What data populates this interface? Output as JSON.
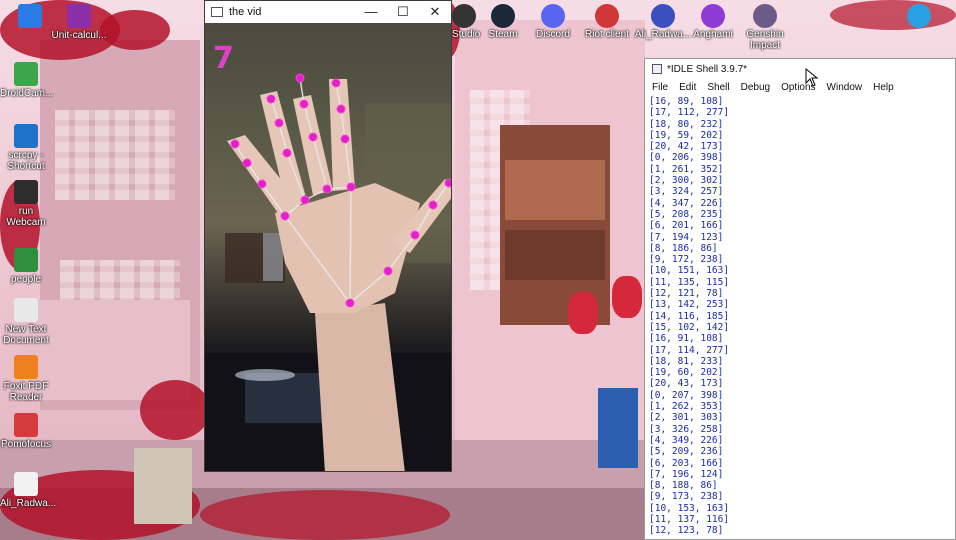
{
  "desktop_icons_left": [
    {
      "label": "",
      "icon": "folder-icon",
      "color": "#2a7be4"
    },
    {
      "label": "Unit-calcul...",
      "icon": "winrar-icon",
      "color": "#8b2fa8"
    },
    {
      "label": "DroidCam...",
      "icon": "droidcam-icon",
      "color": "#3ca64a"
    },
    {
      "label": "scrcpy - Shortcut",
      "icon": "scrcpy-icon",
      "color": "#1e72c8"
    },
    {
      "label": "run Webcam",
      "icon": "webcam-icon",
      "color": "#2d2d2d"
    },
    {
      "label": "people",
      "icon": "people-icon",
      "color": "#2f8f3f"
    },
    {
      "label": "New Text Document",
      "icon": "text-document-icon",
      "color": "#e8e8e8"
    },
    {
      "label": "Foxit PDF Reader",
      "icon": "foxit-icon",
      "color": "#f0801c"
    },
    {
      "label": "Pomofocus",
      "icon": "pomofocus-icon",
      "color": "#d63b3b"
    },
    {
      "label": "Ali_Radwa...",
      "icon": "document-icon",
      "color": "#f2f2f2"
    }
  ],
  "desktop_icons_top": [
    {
      "label": "Studio",
      "icon": "studio-icon",
      "color": "#333"
    },
    {
      "label": "Steam",
      "icon": "steam-icon",
      "color": "#1b2838"
    },
    {
      "label": "Discord",
      "icon": "discord-icon",
      "color": "#5865f2"
    },
    {
      "label": "Riot client",
      "icon": "riot-icon",
      "color": "#d13639"
    },
    {
      "label": "Ali_Radwa...",
      "icon": "pdf-icon",
      "color": "#3c4fbf"
    },
    {
      "label": "Anghami",
      "icon": "anghami-icon",
      "color": "#8e3ad6"
    },
    {
      "label": "Genshin Impact",
      "icon": "genshin-icon",
      "color": "#6b5a8a"
    },
    {
      "label": "",
      "icon": "folder-icon",
      "color": "#2aa0e4"
    }
  ],
  "video_window": {
    "title": "the vid",
    "finger_count": "7",
    "controls": {
      "minimize": "—",
      "maximize": "☐",
      "close": "✕"
    }
  },
  "idle_window": {
    "title": "*IDLE Shell 3.9.7*",
    "menu": [
      "File",
      "Edit",
      "Shell",
      "Debug",
      "Options",
      "Window",
      "Help"
    ],
    "lines": [
      "[16, 89, 108]",
      "[17, 112, 277]",
      "[18, 80, 232]",
      "[19, 59, 202]",
      "[20, 42, 173]",
      "[0, 206, 398]",
      "[1, 261, 352]",
      "[2, 300, 302]",
      "[3, 324, 257]",
      "[4, 347, 226]",
      "[5, 208, 235]",
      "[6, 201, 166]",
      "[7, 194, 123]",
      "[8, 186, 86]",
      "[9, 172, 238]",
      "[10, 151, 163]",
      "[11, 135, 115]",
      "[12, 121, 78]",
      "[13, 142, 253]",
      "[14, 116, 185]",
      "[15, 102, 142]",
      "[16, 91, 108]",
      "[17, 114, 277]",
      "[18, 81, 233]",
      "[19, 60, 202]",
      "[20, 43, 173]",
      "[0, 207, 398]",
      "[1, 262, 353]",
      "[2, 301, 303]",
      "[3, 326, 258]",
      "[4, 349, 226]",
      "[5, 209, 236]",
      "[6, 203, 166]",
      "[7, 196, 124]",
      "[8, 188, 86]",
      "[9, 173, 238]",
      "[10, 153, 163]",
      "[11, 137, 116]",
      "[12, 123, 78]"
    ]
  }
}
